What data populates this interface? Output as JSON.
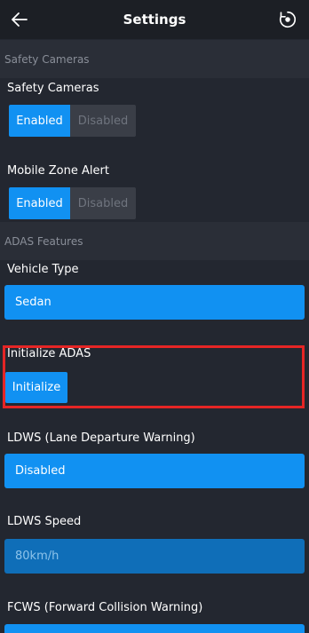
{
  "header": {
    "title": "Settings",
    "back_icon": "back-arrow-icon",
    "reset_icon": "reset-icon"
  },
  "section_safety": {
    "title": "Safety Cameras"
  },
  "safety_cameras": {
    "label": "Safety Cameras",
    "enabled": "Enabled",
    "disabled": "Disabled",
    "selected": "Enabled"
  },
  "mobile_zone": {
    "label": "Mobile Zone Alert",
    "enabled": "Enabled",
    "disabled": "Disabled",
    "selected": "Enabled"
  },
  "section_adas": {
    "title": "ADAS Features"
  },
  "vehicle_type": {
    "label": "Vehicle Type",
    "value": "Sedan"
  },
  "initialize_adas": {
    "label": "Initialize ADAS",
    "button": "Initialize"
  },
  "ldws": {
    "label": "LDWS (Lane Departure Warning)",
    "value": "Disabled"
  },
  "ldws_speed": {
    "label": "LDWS Speed",
    "value": "80km/h"
  },
  "fcws": {
    "label": "FCWS (Forward Collision Warning)"
  },
  "colors": {
    "accent": "#1191f2",
    "background": "#232730",
    "highlight": "#e52525"
  }
}
